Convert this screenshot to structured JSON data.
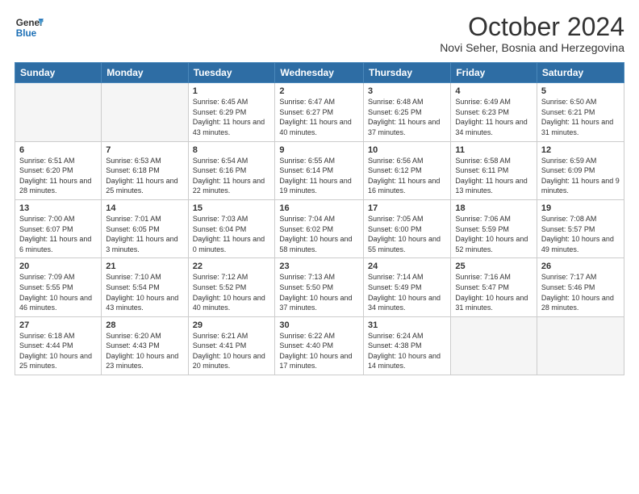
{
  "header": {
    "logo_line1": "General",
    "logo_line2": "Blue",
    "month": "October 2024",
    "location": "Novi Seher, Bosnia and Herzegovina"
  },
  "weekdays": [
    "Sunday",
    "Monday",
    "Tuesday",
    "Wednesday",
    "Thursday",
    "Friday",
    "Saturday"
  ],
  "weeks": [
    [
      {
        "day": "",
        "sunrise": "",
        "sunset": "",
        "daylight": "",
        "empty": true
      },
      {
        "day": "",
        "sunrise": "",
        "sunset": "",
        "daylight": "",
        "empty": true
      },
      {
        "day": "1",
        "sunrise": "Sunrise: 6:45 AM",
        "sunset": "Sunset: 6:29 PM",
        "daylight": "Daylight: 11 hours and 43 minutes."
      },
      {
        "day": "2",
        "sunrise": "Sunrise: 6:47 AM",
        "sunset": "Sunset: 6:27 PM",
        "daylight": "Daylight: 11 hours and 40 minutes."
      },
      {
        "day": "3",
        "sunrise": "Sunrise: 6:48 AM",
        "sunset": "Sunset: 6:25 PM",
        "daylight": "Daylight: 11 hours and 37 minutes."
      },
      {
        "day": "4",
        "sunrise": "Sunrise: 6:49 AM",
        "sunset": "Sunset: 6:23 PM",
        "daylight": "Daylight: 11 hours and 34 minutes."
      },
      {
        "day": "5",
        "sunrise": "Sunrise: 6:50 AM",
        "sunset": "Sunset: 6:21 PM",
        "daylight": "Daylight: 11 hours and 31 minutes."
      }
    ],
    [
      {
        "day": "6",
        "sunrise": "Sunrise: 6:51 AM",
        "sunset": "Sunset: 6:20 PM",
        "daylight": "Daylight: 11 hours and 28 minutes."
      },
      {
        "day": "7",
        "sunrise": "Sunrise: 6:53 AM",
        "sunset": "Sunset: 6:18 PM",
        "daylight": "Daylight: 11 hours and 25 minutes."
      },
      {
        "day": "8",
        "sunrise": "Sunrise: 6:54 AM",
        "sunset": "Sunset: 6:16 PM",
        "daylight": "Daylight: 11 hours and 22 minutes."
      },
      {
        "day": "9",
        "sunrise": "Sunrise: 6:55 AM",
        "sunset": "Sunset: 6:14 PM",
        "daylight": "Daylight: 11 hours and 19 minutes."
      },
      {
        "day": "10",
        "sunrise": "Sunrise: 6:56 AM",
        "sunset": "Sunset: 6:12 PM",
        "daylight": "Daylight: 11 hours and 16 minutes."
      },
      {
        "day": "11",
        "sunrise": "Sunrise: 6:58 AM",
        "sunset": "Sunset: 6:11 PM",
        "daylight": "Daylight: 11 hours and 13 minutes."
      },
      {
        "day": "12",
        "sunrise": "Sunrise: 6:59 AM",
        "sunset": "Sunset: 6:09 PM",
        "daylight": "Daylight: 11 hours and 9 minutes."
      }
    ],
    [
      {
        "day": "13",
        "sunrise": "Sunrise: 7:00 AM",
        "sunset": "Sunset: 6:07 PM",
        "daylight": "Daylight: 11 hours and 6 minutes."
      },
      {
        "day": "14",
        "sunrise": "Sunrise: 7:01 AM",
        "sunset": "Sunset: 6:05 PM",
        "daylight": "Daylight: 11 hours and 3 minutes."
      },
      {
        "day": "15",
        "sunrise": "Sunrise: 7:03 AM",
        "sunset": "Sunset: 6:04 PM",
        "daylight": "Daylight: 11 hours and 0 minutes."
      },
      {
        "day": "16",
        "sunrise": "Sunrise: 7:04 AM",
        "sunset": "Sunset: 6:02 PM",
        "daylight": "Daylight: 10 hours and 58 minutes."
      },
      {
        "day": "17",
        "sunrise": "Sunrise: 7:05 AM",
        "sunset": "Sunset: 6:00 PM",
        "daylight": "Daylight: 10 hours and 55 minutes."
      },
      {
        "day": "18",
        "sunrise": "Sunrise: 7:06 AM",
        "sunset": "Sunset: 5:59 PM",
        "daylight": "Daylight: 10 hours and 52 minutes."
      },
      {
        "day": "19",
        "sunrise": "Sunrise: 7:08 AM",
        "sunset": "Sunset: 5:57 PM",
        "daylight": "Daylight: 10 hours and 49 minutes."
      }
    ],
    [
      {
        "day": "20",
        "sunrise": "Sunrise: 7:09 AM",
        "sunset": "Sunset: 5:55 PM",
        "daylight": "Daylight: 10 hours and 46 minutes."
      },
      {
        "day": "21",
        "sunrise": "Sunrise: 7:10 AM",
        "sunset": "Sunset: 5:54 PM",
        "daylight": "Daylight: 10 hours and 43 minutes."
      },
      {
        "day": "22",
        "sunrise": "Sunrise: 7:12 AM",
        "sunset": "Sunset: 5:52 PM",
        "daylight": "Daylight: 10 hours and 40 minutes."
      },
      {
        "day": "23",
        "sunrise": "Sunrise: 7:13 AM",
        "sunset": "Sunset: 5:50 PM",
        "daylight": "Daylight: 10 hours and 37 minutes."
      },
      {
        "day": "24",
        "sunrise": "Sunrise: 7:14 AM",
        "sunset": "Sunset: 5:49 PM",
        "daylight": "Daylight: 10 hours and 34 minutes."
      },
      {
        "day": "25",
        "sunrise": "Sunrise: 7:16 AM",
        "sunset": "Sunset: 5:47 PM",
        "daylight": "Daylight: 10 hours and 31 minutes."
      },
      {
        "day": "26",
        "sunrise": "Sunrise: 7:17 AM",
        "sunset": "Sunset: 5:46 PM",
        "daylight": "Daylight: 10 hours and 28 minutes."
      }
    ],
    [
      {
        "day": "27",
        "sunrise": "Sunrise: 6:18 AM",
        "sunset": "Sunset: 4:44 PM",
        "daylight": "Daylight: 10 hours and 25 minutes."
      },
      {
        "day": "28",
        "sunrise": "Sunrise: 6:20 AM",
        "sunset": "Sunset: 4:43 PM",
        "daylight": "Daylight: 10 hours and 23 minutes."
      },
      {
        "day": "29",
        "sunrise": "Sunrise: 6:21 AM",
        "sunset": "Sunset: 4:41 PM",
        "daylight": "Daylight: 10 hours and 20 minutes."
      },
      {
        "day": "30",
        "sunrise": "Sunrise: 6:22 AM",
        "sunset": "Sunset: 4:40 PM",
        "daylight": "Daylight: 10 hours and 17 minutes."
      },
      {
        "day": "31",
        "sunrise": "Sunrise: 6:24 AM",
        "sunset": "Sunset: 4:38 PM",
        "daylight": "Daylight: 10 hours and 14 minutes."
      },
      {
        "day": "",
        "sunrise": "",
        "sunset": "",
        "daylight": "",
        "empty": true
      },
      {
        "day": "",
        "sunrise": "",
        "sunset": "",
        "daylight": "",
        "empty": true
      }
    ]
  ]
}
